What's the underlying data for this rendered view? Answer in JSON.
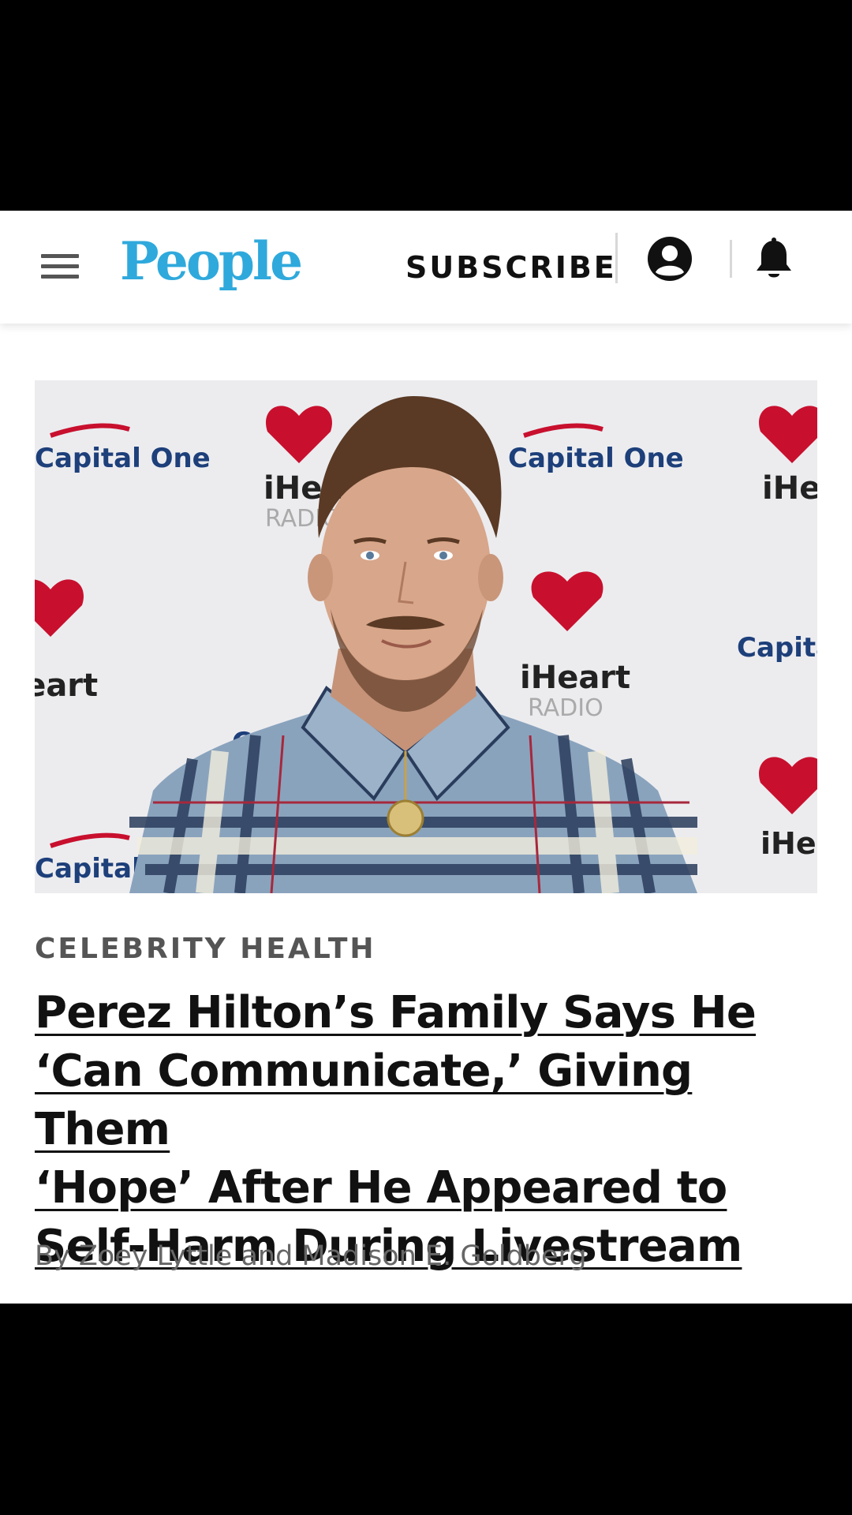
{
  "header": {
    "logo_text": "People",
    "subscribe_label": "SUBSCRIBE",
    "menu_icon": "hamburger-menu-icon",
    "account_icon": "account-circle-icon",
    "notification_icon": "bell-icon"
  },
  "hero_image": {
    "backdrop_text": {
      "brand1": "Capital One",
      "brand2": "iHeart",
      "brand2_sub": "RADIO"
    }
  },
  "article": {
    "category": "CELEBRITY HEALTH",
    "headline_lines": [
      "Perez Hilton’s Family Says He",
      "‘Can Communicate,’ Giving Them",
      "‘Hope’ After He Appeared to",
      "Self-Harm During Livestream"
    ],
    "byline": "By Zoey Lyttle and Madison E. Goldberg"
  },
  "colors": {
    "brand": "#2fa9dc",
    "text": "#111111",
    "muted": "#555555",
    "iheart_red": "#c8102e"
  }
}
